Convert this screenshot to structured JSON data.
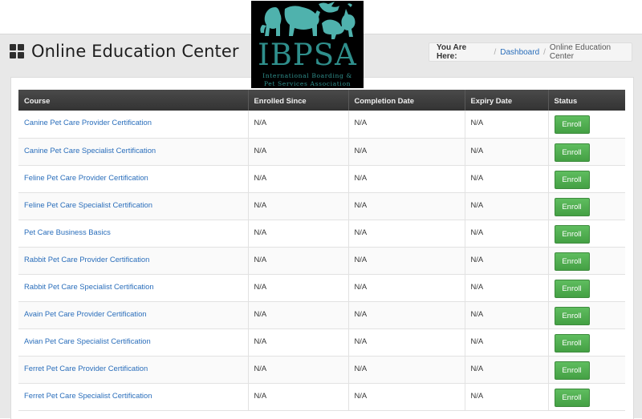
{
  "header": {
    "title": "Online Education Center",
    "breadcrumb": {
      "label": "You Are Here:",
      "separator": "/",
      "items": [
        "Dashboard",
        "Online Education Center"
      ]
    }
  },
  "logo": {
    "text": "IBPSA",
    "subtitle_line1": "International Boarding &",
    "subtitle_line2": "Pet Services Association"
  },
  "table": {
    "columns": [
      "Course",
      "Enrolled Since",
      "Completion Date",
      "Expiry Date",
      "Status"
    ],
    "rows": [
      {
        "course": "Canine Pet Care Provider Certification",
        "enrolled": "N/A",
        "completed": "N/A",
        "expiry": "N/A",
        "action": "Enroll"
      },
      {
        "course": "Canine Pet Care Specialist Certification",
        "enrolled": "N/A",
        "completed": "N/A",
        "expiry": "N/A",
        "action": "Enroll"
      },
      {
        "course": "Feline Pet Care Provider Certification",
        "enrolled": "N/A",
        "completed": "N/A",
        "expiry": "N/A",
        "action": "Enroll"
      },
      {
        "course": "Feline Pet Care Specialist Certification",
        "enrolled": "N/A",
        "completed": "N/A",
        "expiry": "N/A",
        "action": "Enroll"
      },
      {
        "course": "Pet Care Business Basics",
        "enrolled": "N/A",
        "completed": "N/A",
        "expiry": "N/A",
        "action": "Enroll"
      },
      {
        "course": "Rabbit Pet Care Provider Certification",
        "enrolled": "N/A",
        "completed": "N/A",
        "expiry": "N/A",
        "action": "Enroll"
      },
      {
        "course": "Rabbit Pet Care Specialist Certification",
        "enrolled": "N/A",
        "completed": "N/A",
        "expiry": "N/A",
        "action": "Enroll"
      },
      {
        "course": "Avain Pet Care Provider Certification",
        "enrolled": "N/A",
        "completed": "N/A",
        "expiry": "N/A",
        "action": "Enroll"
      },
      {
        "course": "Avian Pet Care Specialist Certification",
        "enrolled": "N/A",
        "completed": "N/A",
        "expiry": "N/A",
        "action": "Enroll"
      },
      {
        "course": "Ferret Pet Care Provider Certification",
        "enrolled": "N/A",
        "completed": "N/A",
        "expiry": "N/A",
        "action": "Enroll"
      },
      {
        "course": "Ferret Pet Care Specialist Certification",
        "enrolled": "N/A",
        "completed": "N/A",
        "expiry": "N/A",
        "action": "Enroll"
      }
    ]
  },
  "colors": {
    "header_bg": "#e8e8e8",
    "table_header_bg": "#3a3a3a",
    "link": "#2a6ebb",
    "enroll_button": "#5cb85c",
    "logo_bg": "#000000",
    "logo_teal": "#2f8f8c"
  },
  "icons": {
    "title": "grid-icon",
    "logo_art": "animals-silhouette-icon"
  }
}
